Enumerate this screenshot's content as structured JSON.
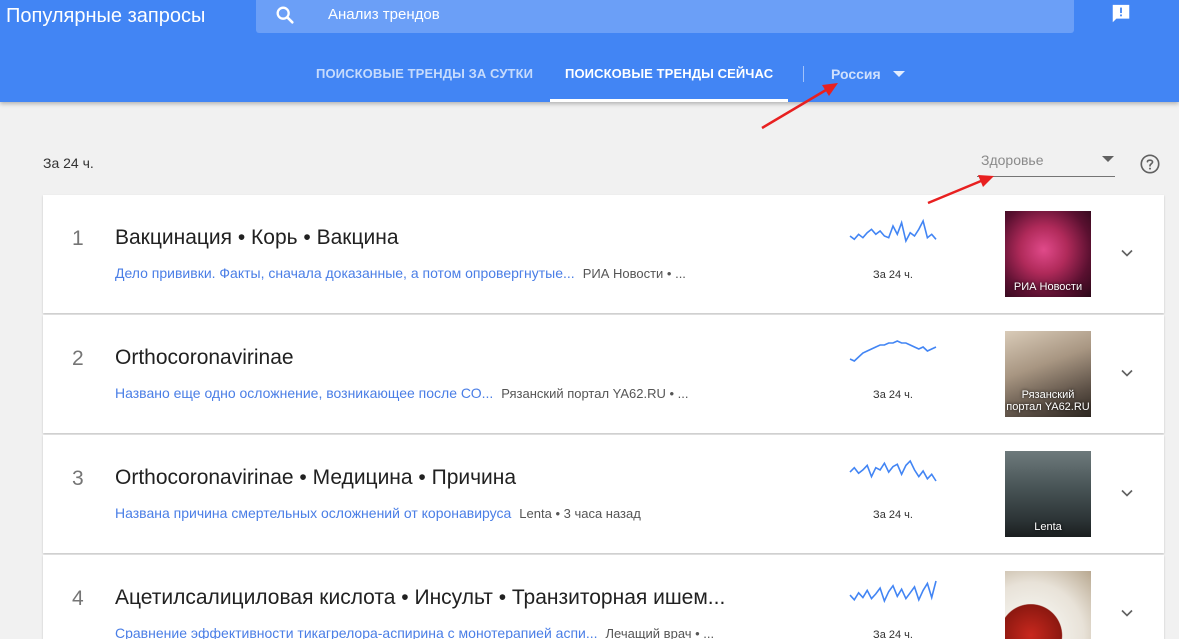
{
  "header": {
    "app_title": "Популярные запросы",
    "search_text": "Анализ трендов",
    "tab_day": "ПОИСКОВЫЕ ТРЕНДЫ ЗА СУТКИ",
    "tab_now": "ПОИСКОВЫЕ ТРЕНДЫ СЕЙЧАС",
    "region": "Россия"
  },
  "filters": {
    "period": "За 24 ч.",
    "category": "Здоровье"
  },
  "trends": [
    {
      "rank": "1",
      "title": "Вакцинация • Корь • Вакцина",
      "link": "Дело прививки. Факты, сначала доказанные, а потом опровергнутые...",
      "source": "РИА Новости • ...",
      "spark_label": "За 24 ч.",
      "thumb_label": "РИА Новости",
      "spark": [
        8,
        6,
        9,
        7,
        10,
        12,
        9,
        11,
        8,
        7,
        14,
        9,
        16,
        5,
        10,
        8,
        12,
        17,
        7,
        9,
        6
      ]
    },
    {
      "rank": "2",
      "title": "Orthocoronavirinae",
      "link": "Названо еще одно осложнение, возникающее после СО...",
      "source": "Рязанский портал YA62.RU • ...",
      "spark_label": "За 24 ч.",
      "thumb_label": "Рязанский портал YA62.RU",
      "spark": [
        4,
        3,
        5,
        7,
        8,
        9,
        10,
        11,
        11,
        12,
        12,
        13,
        12,
        12,
        11,
        10,
        9,
        10,
        8,
        9,
        10
      ]
    },
    {
      "rank": "3",
      "title": "Orthocoronavirinae • Медицина • Причина",
      "link": "Названа причина смертельных осложнений от коронавируса",
      "source": "Lenta • 3 часа назад",
      "spark_label": "За 24 ч.",
      "thumb_label": "Lenta",
      "spark": [
        10,
        14,
        9,
        12,
        16,
        6,
        14,
        12,
        18,
        10,
        15,
        17,
        8,
        16,
        20,
        12,
        6,
        11,
        4,
        8,
        2
      ]
    },
    {
      "rank": "4",
      "title": "Ацетилсалициловая кислота • Инсульт • Транзиторная ишем...",
      "link": "Сравнение эффективности тикагрелора-аспирина с монотерапией аспи...",
      "source": "Лечащий врач • ...",
      "spark_label": "За 24 ч.",
      "thumb_label": "",
      "spark": [
        12,
        8,
        14,
        10,
        16,
        9,
        13,
        18,
        7,
        15,
        20,
        11,
        17,
        9,
        14,
        19,
        8,
        16,
        22,
        10,
        24
      ]
    }
  ],
  "colors": {
    "header_bg": "#4285f4",
    "link": "#4a7ee6",
    "spark": "#4285f4",
    "annotation_arrow": "#e82020"
  }
}
